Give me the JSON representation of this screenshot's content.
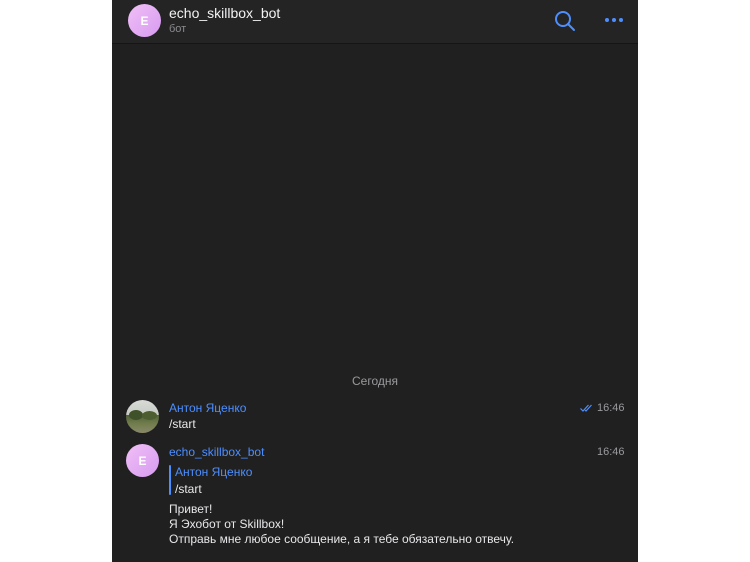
{
  "header": {
    "avatar_letter": "E",
    "title": "echo_skillbox_bot",
    "subtitle": "бот",
    "search_icon": "search-icon",
    "more_icon": "more-icon"
  },
  "chat": {
    "date_separator": "Сегодня",
    "messages": [
      {
        "sender": "Антон Яценко",
        "text": "/start",
        "time": "16:46",
        "status": "read"
      },
      {
        "sender": "echo_skillbox_bot",
        "avatar_letter": "E",
        "time": "16:46",
        "reply_to": {
          "sender": "Антон Яценко",
          "text": "/start"
        },
        "lines": [
          "Привет!",
          "Я Эхобот от Skillbox!",
          "Отправь мне любое сообщение, а я тебе обязательно отвечу."
        ]
      }
    ]
  },
  "colors": {
    "accent": "#4d8eff",
    "background": "#202021",
    "header": "#242425"
  }
}
